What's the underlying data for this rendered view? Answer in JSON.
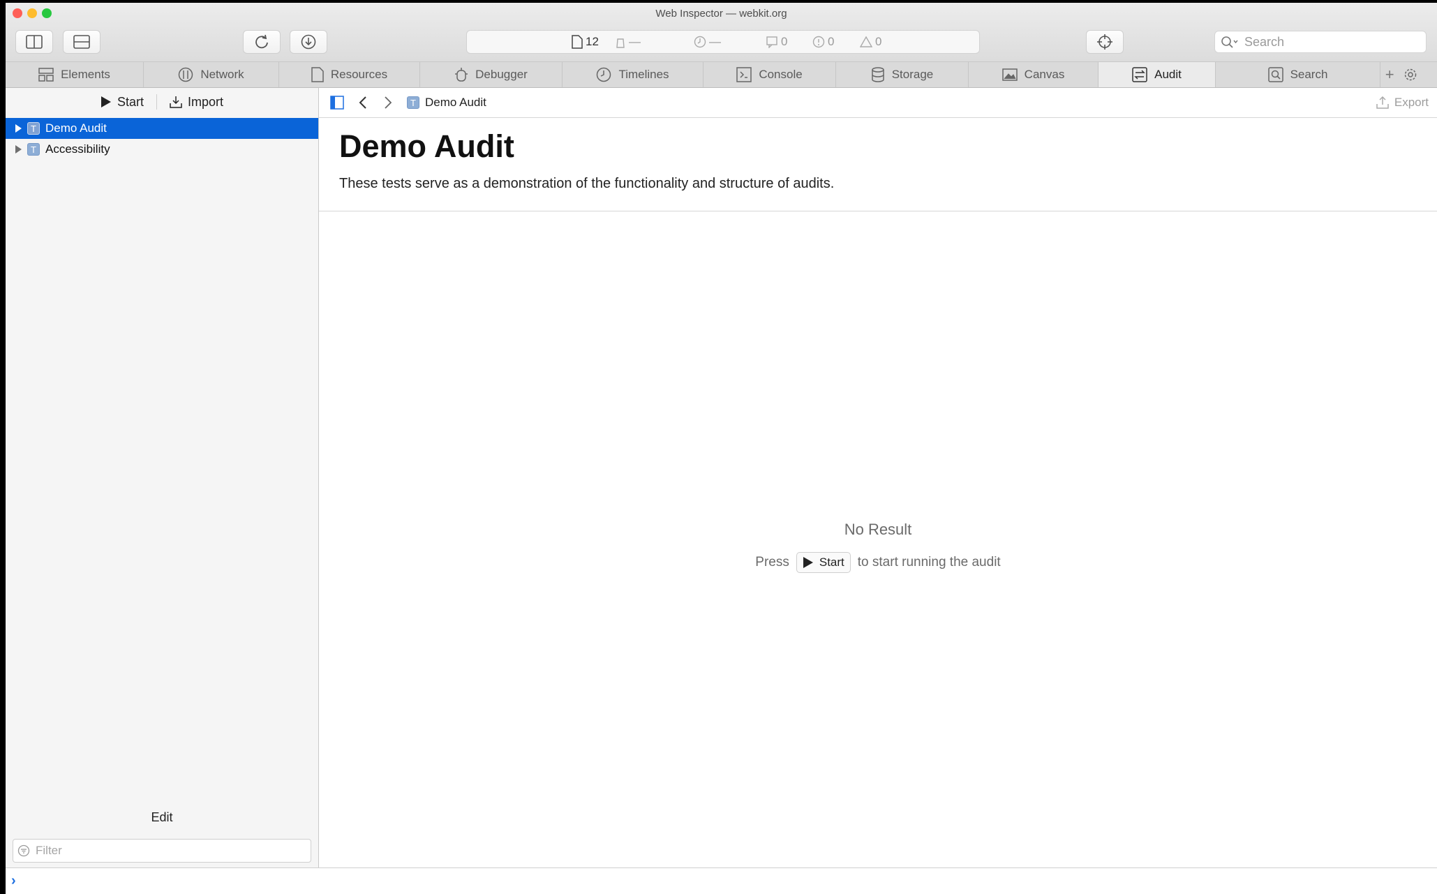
{
  "window": {
    "title": "Web Inspector — webkit.org"
  },
  "activity": {
    "resources": "12",
    "network_load": "—",
    "load_time": "—",
    "logs": "0",
    "errors": "0",
    "warnings": "0"
  },
  "toolbar": {
    "search_placeholder": "Search"
  },
  "tabs": [
    {
      "label": "Elements",
      "icon": "elements-icon"
    },
    {
      "label": "Network",
      "icon": "network-icon"
    },
    {
      "label": "Resources",
      "icon": "resources-icon"
    },
    {
      "label": "Debugger",
      "icon": "debugger-icon"
    },
    {
      "label": "Timelines",
      "icon": "timelines-icon"
    },
    {
      "label": "Console",
      "icon": "console-icon"
    },
    {
      "label": "Storage",
      "icon": "storage-icon"
    },
    {
      "label": "Canvas",
      "icon": "canvas-icon"
    },
    {
      "label": "Audit",
      "icon": "audit-icon",
      "active": true
    },
    {
      "label": "Search",
      "icon": "search-tab-icon"
    }
  ],
  "sidebar": {
    "start_label": "Start",
    "import_label": "Import",
    "items": [
      {
        "label": "Demo Audit",
        "icon_letter": "T",
        "selected": true
      },
      {
        "label": "Accessibility",
        "icon_letter": "T",
        "selected": false
      }
    ],
    "edit_label": "Edit",
    "filter_placeholder": "Filter"
  },
  "content": {
    "breadcrumb": "Demo Audit",
    "breadcrumb_icon_letter": "T",
    "export_label": "Export",
    "title": "Demo Audit",
    "description": "These tests serve as a demonstration of the functionality and structure of audits.",
    "no_result": "No Result",
    "press_text": "Press",
    "start_label": "Start",
    "after_text": "to start running the audit"
  },
  "colors": {
    "selection": "#0a64d8",
    "prompt": "#1d6fe0"
  }
}
